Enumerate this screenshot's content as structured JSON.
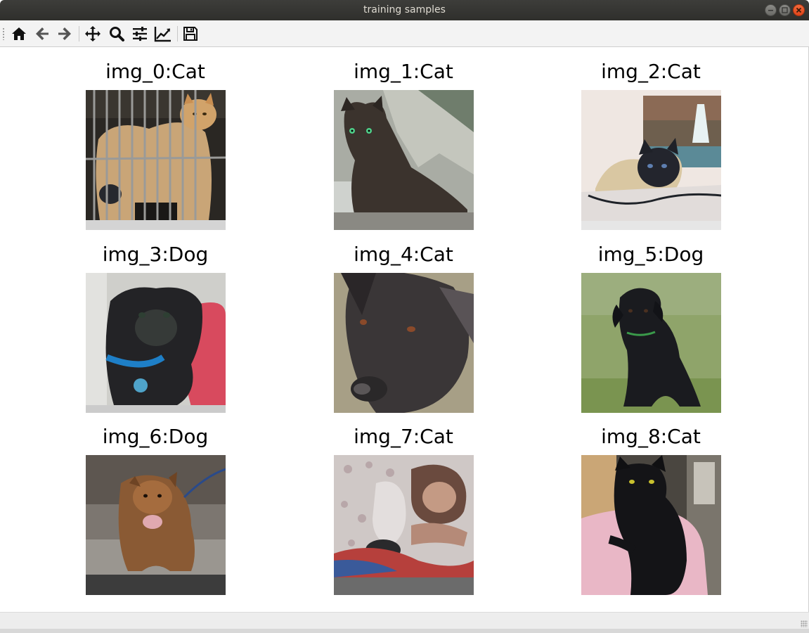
{
  "window": {
    "title": "training samples",
    "buttons": [
      "minimize",
      "maximize",
      "close"
    ]
  },
  "toolbar": {
    "items": [
      {
        "name": "home-icon",
        "tooltip": "Home"
      },
      {
        "name": "back-icon",
        "tooltip": "Back"
      },
      {
        "name": "forward-icon",
        "tooltip": "Forward"
      },
      {
        "name": "pan-icon",
        "tooltip": "Pan"
      },
      {
        "name": "zoom-icon",
        "tooltip": "Zoom"
      },
      {
        "name": "subplots-icon",
        "tooltip": "Subplots"
      },
      {
        "name": "customize-icon",
        "tooltip": "Customize"
      },
      {
        "name": "save-icon",
        "tooltip": "Save"
      }
    ]
  },
  "figure": {
    "grid": "3x3",
    "samples": [
      {
        "title": "img_0:Cat",
        "label": "Cat"
      },
      {
        "title": "img_1:Cat",
        "label": "Cat"
      },
      {
        "title": "img_2:Cat",
        "label": "Cat"
      },
      {
        "title": "img_3:Dog",
        "label": "Dog"
      },
      {
        "title": "img_4:Cat",
        "label": "Cat"
      },
      {
        "title": "img_5:Dog",
        "label": "Dog"
      },
      {
        "title": "img_6:Dog",
        "label": "Dog"
      },
      {
        "title": "img_7:Cat",
        "label": "Cat"
      },
      {
        "title": "img_8:Cat",
        "label": "Cat"
      }
    ]
  },
  "colors": {
    "titlebar": "#2f2f2c",
    "close_button": "#e0451a",
    "toolbar_bg": "#f3f3f3",
    "canvas_bg": "#ffffff"
  }
}
